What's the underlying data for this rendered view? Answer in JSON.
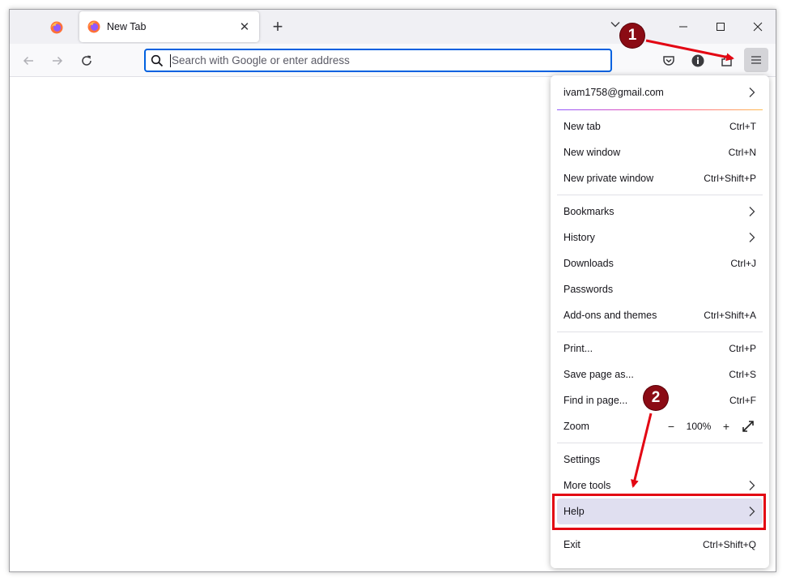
{
  "browser": {
    "tab_title": "New Tab",
    "tab_close_glyph": "✕",
    "new_tab_glyph": "+",
    "accent_color": "#0061e0",
    "icons": {
      "pinned_tab": "firefox-logo-icon",
      "tab_favicon": "firefox-logo-icon",
      "list_all_tabs": "chevron-down-icon",
      "minimize": "minimize-icon",
      "maximize": "maximize-icon",
      "close": "close-icon",
      "back": "back-arrow-icon",
      "forward": "forward-arrow-icon",
      "reload": "reload-icon",
      "search": "search-icon",
      "pocket": "pocket-icon",
      "extension": "info-icon",
      "extensions": "extensions-icon",
      "menu": "hamburger-menu-icon"
    }
  },
  "urlbar": {
    "placeholder": "Search with Google or enter address",
    "value": ""
  },
  "menu": {
    "account": "ivam1758@gmail.com",
    "items_group1": [
      {
        "label": "New tab",
        "shortcut": "Ctrl+T"
      },
      {
        "label": "New window",
        "shortcut": "Ctrl+N"
      },
      {
        "label": "New private window",
        "shortcut": "Ctrl+Shift+P"
      }
    ],
    "items_group2": [
      {
        "label": "Bookmarks",
        "shortcut": "",
        "submenu": true
      },
      {
        "label": "History",
        "shortcut": "",
        "submenu": true
      },
      {
        "label": "Downloads",
        "shortcut": "Ctrl+J"
      },
      {
        "label": "Passwords",
        "shortcut": ""
      },
      {
        "label": "Add-ons and themes",
        "shortcut": "Ctrl+Shift+A"
      }
    ],
    "items_group3": [
      {
        "label": "Print...",
        "shortcut": "Ctrl+P"
      },
      {
        "label": "Save page as...",
        "shortcut": "Ctrl+S"
      },
      {
        "label": "Find in page...",
        "shortcut": "Ctrl+F"
      }
    ],
    "zoom": {
      "label": "Zoom",
      "minus": "−",
      "value": "100%",
      "plus": "+"
    },
    "items_group4": [
      {
        "label": "Settings",
        "shortcut": ""
      },
      {
        "label": "More tools",
        "shortcut": "",
        "submenu": true
      },
      {
        "label": "Help",
        "shortcut": "",
        "submenu": true
      }
    ],
    "exit": {
      "label": "Exit",
      "shortcut": "Ctrl+Shift+Q"
    }
  },
  "annotations": {
    "step1": "1",
    "step2": "2",
    "badge_color": "#8b0b14",
    "arrow_color": "#e30613"
  }
}
